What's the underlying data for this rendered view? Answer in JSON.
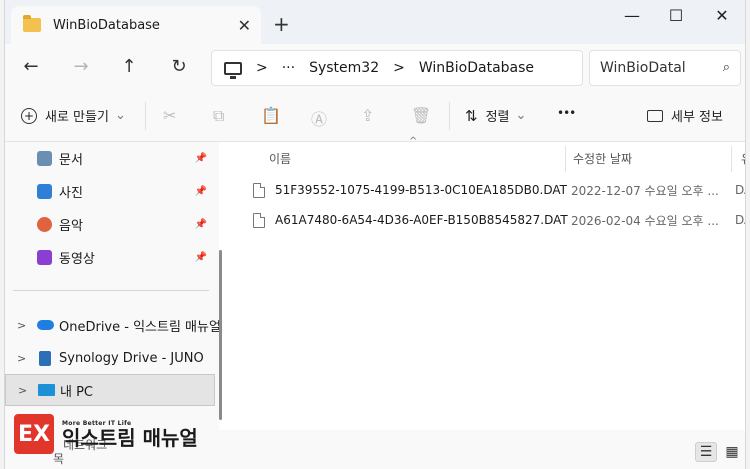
{
  "titlebar": {
    "tab_title": "WinBioDatabase",
    "close_glyph": "✕",
    "new_tab_glyph": "+",
    "minimize_glyph": "—",
    "maximize_glyph": "☐",
    "window_close_glyph": "✕"
  },
  "nav": {
    "back": "←",
    "forward": "→",
    "up": "↑",
    "refresh": "↻",
    "address": {
      "more": "···",
      "chevron": ">",
      "crumbs": [
        "System32",
        "WinBioDatabase"
      ]
    },
    "search_placeholder": "WinBioDatal",
    "search_icon": "⌕"
  },
  "commands": {
    "new_label": "새로 만들기",
    "new_chevron": "⌄",
    "cut_icon": "✂",
    "copy_icon": "⧉",
    "paste_icon": "📋",
    "rename_icon": "Ⓐ",
    "share_icon": "⇪",
    "delete_icon": "🗑",
    "sort_icon": "⇅",
    "sort_label": "정렬",
    "sort_chevron": "⌄",
    "more_icon": "•••",
    "details_label": "세부 정보"
  },
  "sidebar": {
    "pin_glyph": "📌",
    "expand_glyph": ">",
    "items": [
      {
        "label": "문서",
        "color": "#6b8fb3"
      },
      {
        "label": "사진",
        "color": "#2f7fd6"
      },
      {
        "label": "음악",
        "color": "#e0623e"
      },
      {
        "label": "동영상",
        "color": "#8a3fd1"
      }
    ],
    "drives": [
      {
        "label": "OneDrive - 익스트림 매뉴얼",
        "color": "#1e7fe0"
      },
      {
        "label": "Synology Drive - JUNO",
        "color": "#2a6fb8"
      },
      {
        "label": "내 PC",
        "color": "#1e90d6"
      }
    ]
  },
  "content": {
    "sort_indicator": "^",
    "columns": [
      "이름",
      "수정한 날짜",
      "유"
    ],
    "rows": [
      {
        "name": "51F39552-1075-4199-B513-0C10EA185DB0.DAT",
        "date": "2022-12-07 수요일 오후 ...",
        "type": "DA"
      },
      {
        "name": "A61A7480-6A54-4D36-A0EF-B150B8545827.DAT",
        "date": "2026-02-04 수요일 오후 ...",
        "type": "DA"
      }
    ]
  },
  "status": {
    "partial_label": "네트워크",
    "partial_label2": "목",
    "list_view_icon": "☰",
    "tile_view_icon": "▦"
  },
  "watermark": {
    "tag": "More Better IT Life",
    "brand": "익스트림 매뉴얼",
    "badge": "EX"
  }
}
